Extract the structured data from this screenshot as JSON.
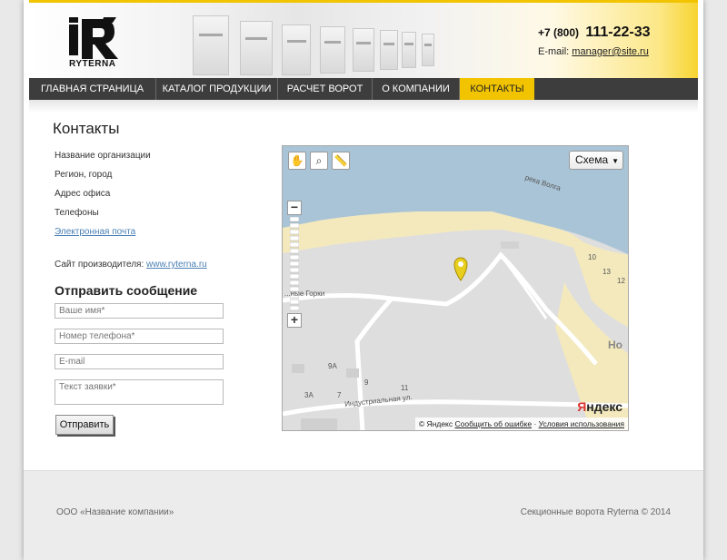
{
  "header": {
    "logo_text": "RYTERNA",
    "phone_prefix": "+7 (800)",
    "phone_number": "111-22-33",
    "email_label": "E-mail:",
    "email": "manager@site.ru"
  },
  "nav": {
    "items": [
      {
        "label": "ГЛАВНАЯ СТРАНИЦА"
      },
      {
        "label": "КАТАЛОГ ПРОДУКЦИИ"
      },
      {
        "label": "РАСЧЕТ ВОРОТ"
      },
      {
        "label": "О КОМПАНИИ"
      },
      {
        "label": "КОНТАКТЫ"
      }
    ],
    "active": "КОНТАКТЫ"
  },
  "page_title": "Контакты",
  "info": {
    "org": "Название организации",
    "region": "Регион, город",
    "address": "Адрес офиса",
    "phones": "Телефоны",
    "email_link": "Электронная почта",
    "site_label": "Сайт производителя:",
    "site_link": "www.ryterna.ru"
  },
  "form": {
    "title": "Отправить сообщение",
    "name_placeholder": "Ваше имя*",
    "phone_placeholder": "Номер телефона*",
    "email_placeholder": "E-mail",
    "message_placeholder": "Текст заявки*",
    "submit_label": "Отправить"
  },
  "map": {
    "layer_button": "Схема",
    "zoom_in": "+",
    "zoom_out": "−",
    "labels": {
      "river": "река Волга",
      "gorki": "...ные Горки",
      "street": "Индустриальная ул.",
      "n10": "10",
      "n13": "13",
      "n12": "12",
      "no": "Но",
      "n9a": "9А",
      "n9": "9",
      "n11": "11",
      "n3a": "3А",
      "n7": "7"
    },
    "brand_first": "Я",
    "brand_rest": "ндекс",
    "copyright": "© Яндекс",
    "report_link": "Сообщить об ошибке",
    "separator": "·",
    "terms_link": "Условия использования"
  },
  "footer": {
    "left": "ООО «Название компании»",
    "right": "Секционные ворота Ryterna © 2014"
  },
  "colors": {
    "accent": "#f2c400",
    "nav_bg": "#3d3d3d",
    "link": "#4a7fb5",
    "water": "#a9c4d6",
    "sand": "#f3e9bd"
  }
}
